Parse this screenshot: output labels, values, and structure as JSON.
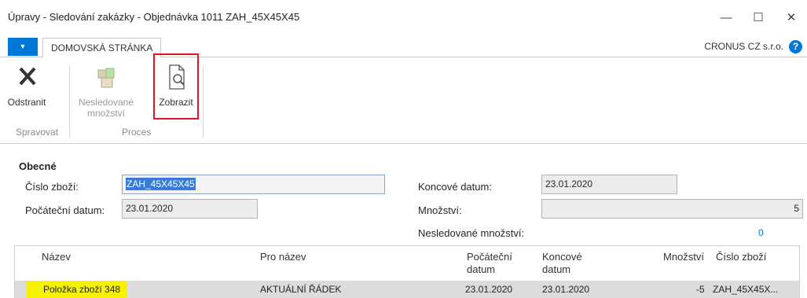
{
  "window": {
    "title": "Úpravy - Sledování zakázky - Objednávka 1011 ZAH_45X45X45",
    "minimize_glyph": "—",
    "maximize_glyph": "☐",
    "close_glyph": "✕"
  },
  "ribbon_tabs": {
    "app_menu_glyph": "▼",
    "home_tab": "DOMOVSKÁ STRÁNKA",
    "company": "CRONUS CZ s.r.o.",
    "help_glyph": "?"
  },
  "ribbon": {
    "delete_label": "Odstranit",
    "untracked_label_line1": "Nesledované",
    "untracked_label_line2": "množství",
    "show_label": "Zobrazit",
    "group_manage": "Spravovat",
    "group_process": "Proces"
  },
  "general": {
    "section_title": "Obecné",
    "item_no_label": "Číslo zboží:",
    "item_no_value": "ZAH_45X45X45",
    "start_date_label": "Počáteční datum:",
    "start_date_value": "23.01.2020",
    "end_date_label": "Koncové datum:",
    "end_date_value": "23.01.2020",
    "quantity_label": "Množství:",
    "quantity_value": "5",
    "untracked_qty_label": "Nesledované množství:",
    "untracked_qty_value": "0"
  },
  "grid": {
    "headers": {
      "name": "Název",
      "for_name": "Pro název",
      "start_date_1": "Počáteční",
      "start_date_2": "datum",
      "end_date_1": "Koncové",
      "end_date_2": "datum",
      "quantity": "Množství",
      "item_no": "Číslo zboží"
    },
    "rows": [
      {
        "name": "Položka zboží 348",
        "for_name": "AKTUÁLNÍ ŘÁDEK",
        "start_date": "23.01.2020",
        "end_date": "23.01.2020",
        "quantity": "-5",
        "item_no": "ZAH_45X45X..."
      }
    ]
  },
  "colors": {
    "accent": "#0078d7",
    "highlight_box": "#e81123",
    "row_highlight": "#f7f200"
  },
  "icons": {
    "delete": "close-x-icon",
    "untracked": "boxes-icon",
    "show": "document-magnifier-icon"
  }
}
